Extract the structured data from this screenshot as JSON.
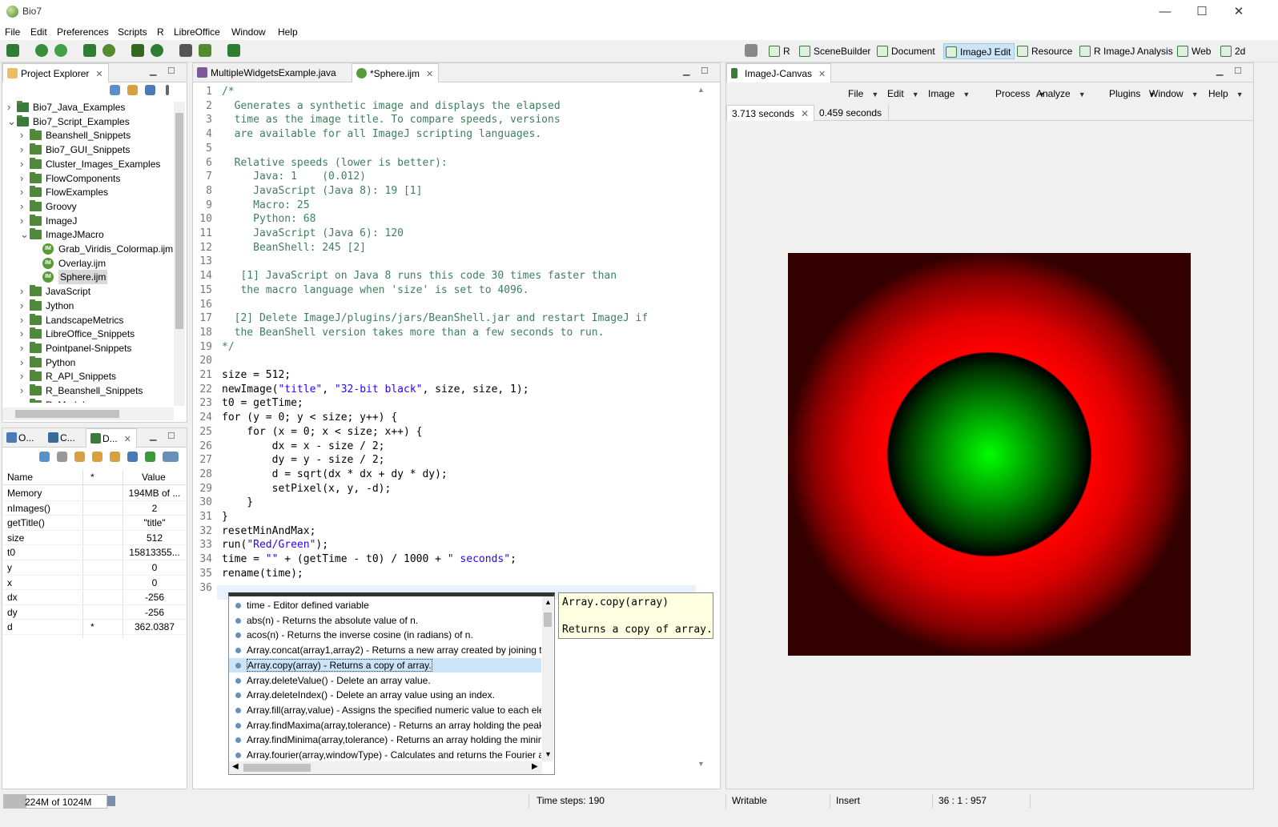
{
  "window": {
    "title": "Bio7",
    "minimize": "—",
    "maximize": "☐",
    "close": "✕"
  },
  "menu": [
    "File",
    "Edit",
    "Preferences",
    "Scripts",
    "R",
    "LibreOffice",
    "Window",
    "Help"
  ],
  "perspectives": [
    {
      "label": "R",
      "active": false
    },
    {
      "label": "SceneBuilder",
      "active": false
    },
    {
      "label": "Document",
      "active": false
    },
    {
      "label": "ImageJ Edit",
      "active": true
    },
    {
      "label": "Resource",
      "active": false
    },
    {
      "label": "R ImageJ Analysis",
      "active": false
    },
    {
      "label": "Web",
      "active": false
    },
    {
      "label": "2d",
      "active": false
    }
  ],
  "project_explorer": {
    "tab": "Project Explorer",
    "items": [
      {
        "label": "Bio7_Java_Examples",
        "level": 0,
        "expanded": false,
        "type": "project"
      },
      {
        "label": "Bio7_Script_Examples",
        "level": 0,
        "expanded": true,
        "type": "project"
      },
      {
        "label": "Beanshell_Snippets",
        "level": 1,
        "expanded": false,
        "type": "folder"
      },
      {
        "label": "Bio7_GUI_Snippets",
        "level": 1,
        "expanded": false,
        "type": "folder"
      },
      {
        "label": "Cluster_Images_Examples",
        "level": 1,
        "expanded": false,
        "type": "folder"
      },
      {
        "label": "FlowComponents",
        "level": 1,
        "expanded": false,
        "type": "folder"
      },
      {
        "label": "FlowExamples",
        "level": 1,
        "expanded": false,
        "type": "folder"
      },
      {
        "label": "Groovy",
        "level": 1,
        "expanded": false,
        "type": "folder"
      },
      {
        "label": "ImageJ",
        "level": 1,
        "expanded": false,
        "type": "folder"
      },
      {
        "label": "ImageJMacro",
        "level": 1,
        "expanded": true,
        "type": "folder"
      },
      {
        "label": "Grab_Viridis_Colormap.ijm",
        "level": 2,
        "type": "file"
      },
      {
        "label": "Overlay.ijm",
        "level": 2,
        "type": "file"
      },
      {
        "label": "Sphere.ijm",
        "level": 2,
        "type": "file",
        "selected": true
      },
      {
        "label": "JavaScript",
        "level": 1,
        "expanded": false,
        "type": "folder"
      },
      {
        "label": "Jython",
        "level": 1,
        "expanded": false,
        "type": "folder"
      },
      {
        "label": "LandscapeMetrics",
        "level": 1,
        "expanded": false,
        "type": "folder"
      },
      {
        "label": "LibreOffice_Snippets",
        "level": 1,
        "expanded": false,
        "type": "folder"
      },
      {
        "label": "Pointpanel-Snippets",
        "level": 1,
        "expanded": false,
        "type": "folder"
      },
      {
        "label": "Python",
        "level": 1,
        "expanded": false,
        "type": "folder"
      },
      {
        "label": "R_API_Snippets",
        "level": 1,
        "expanded": false,
        "type": "folder"
      },
      {
        "label": "R_Beanshell_Snippets",
        "level": 1,
        "expanded": false,
        "type": "folder"
      },
      {
        "label": "R_Markdown",
        "level": 1,
        "expanded": false,
        "type": "folder"
      }
    ]
  },
  "debug_panel": {
    "tabs": [
      "O...",
      "C...",
      "D..."
    ],
    "headers": [
      "Name",
      "*",
      "Value"
    ],
    "rows": [
      {
        "name": "Memory",
        "star": "",
        "value": "194MB of ..."
      },
      {
        "name": "nImages()",
        "star": "",
        "value": "2"
      },
      {
        "name": "getTitle()",
        "star": "",
        "value": "\"title\""
      },
      {
        "name": "size",
        "star": "",
        "value": "512"
      },
      {
        "name": "t0",
        "star": "",
        "value": "15813355..."
      },
      {
        "name": "y",
        "star": "",
        "value": "0"
      },
      {
        "name": "x",
        "star": "",
        "value": "0"
      },
      {
        "name": "dx",
        "star": "",
        "value": "-256"
      },
      {
        "name": "dy",
        "star": "",
        "value": "-256"
      },
      {
        "name": "d",
        "star": "*",
        "value": "362.0387"
      }
    ]
  },
  "editor": {
    "tabs": [
      {
        "label": "MultipleWidgetsExample.java",
        "selected": false
      },
      {
        "label": "*Sphere.ijm",
        "selected": true
      }
    ]
  },
  "autocomplete": {
    "items": [
      "time - Editor defined variable",
      "abs(n) - Returns the absolute value of n.",
      "acos(n) - Returns the inverse cosine (in radians) of n.",
      "Array.concat(array1,array2) - Returns a new array created by joining two",
      "Array.copy(array) - Returns a copy of array.",
      "Array.deleteValue() - Delete an array value.",
      "Array.deleteIndex() - Delete an array value using an index.",
      "Array.fill(array,value) - Assigns the specified numeric value to each elem",
      "Array.findMaxima(array,tolerance) - Returns an array holding the peak p",
      "Array.findMinima(array,tolerance) - Returns an array holding the minim",
      "Array.fourier(array,windowType) - Calculates and returns the Fourier am"
    ],
    "selected_index": 4,
    "tooltip_title": "Array.copy(array)",
    "tooltip_body": "Returns a copy of array."
  },
  "imagej": {
    "tab": "ImageJ-Canvas",
    "menus": [
      "File",
      "Edit",
      "Image",
      "Process",
      "Analyze",
      "Plugins",
      "Window",
      "Help"
    ],
    "image_tabs": [
      {
        "label": "3.713 seconds",
        "selected": true
      },
      {
        "label": "0.459 seconds",
        "selected": false
      }
    ]
  },
  "status": {
    "memory": "224M of 1024M",
    "time_steps": "Time steps: 190",
    "writable": "Writable",
    "insert": "Insert",
    "position": "36 : 1 : 957"
  }
}
